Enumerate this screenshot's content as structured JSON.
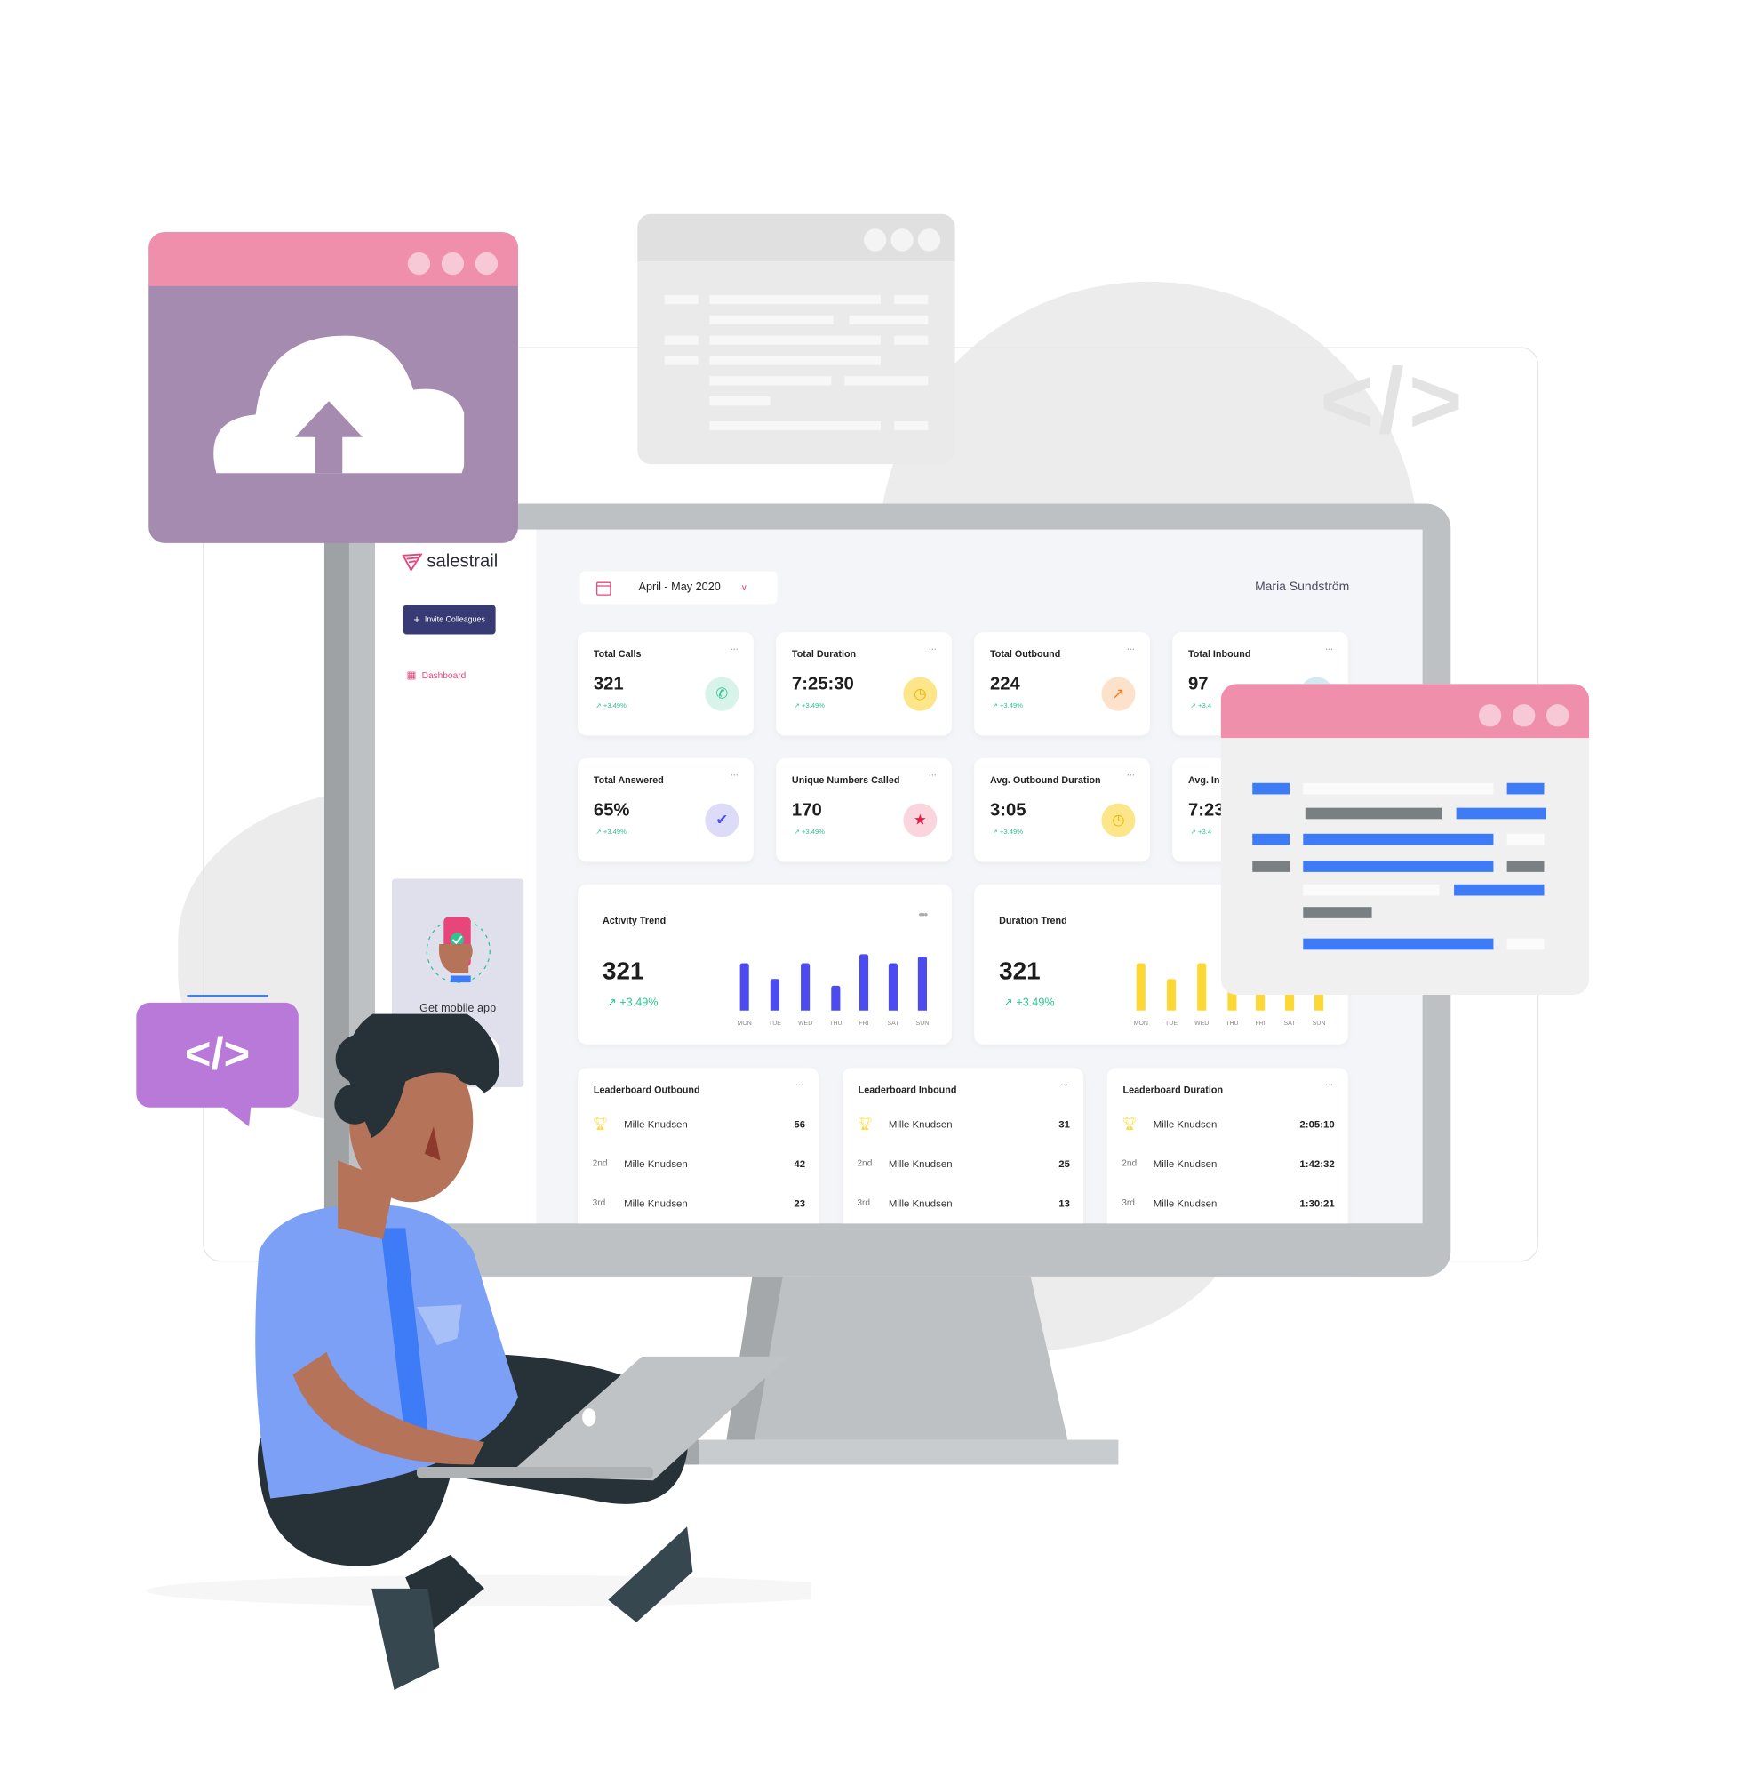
{
  "brand": {
    "logo": "salestrail",
    "accent": "#e8457a",
    "button_color": "#373a73"
  },
  "sidebar": {
    "invite_label": "Invite Colleagues",
    "nav": [
      {
        "label": "Dashboard",
        "icon": "grid-icon",
        "active": true
      }
    ],
    "mobile_label": "Get mobile app"
  },
  "header": {
    "date_range": "April - May 2020",
    "user_name": "Maria Sundström"
  },
  "stats": [
    {
      "title": "Total Calls",
      "value": "321",
      "change": "+3.49%",
      "icon": "phone-icon",
      "icon_bg": "#d8f3ea",
      "icon_color": "#2bc592"
    },
    {
      "title": "Total Duration",
      "value": "7:25:30",
      "change": "+3.49%",
      "icon": "clock-icon",
      "icon_bg": "#fde68a",
      "icon_color": "#e8b400"
    },
    {
      "title": "Total Outbound",
      "value": "224",
      "change": "+3.49%",
      "icon": "outgoing-call-icon",
      "icon_bg": "#fde2cb",
      "icon_color": "#f07a1a"
    },
    {
      "title": "Total Inbound",
      "value": "97",
      "change": "+3.4",
      "icon": "incoming-call-icon",
      "icon_bg": "#cfeaf0",
      "icon_color": "#3aa6c0"
    },
    {
      "title": "Total Answered",
      "value": "65%",
      "change": "+3.49%",
      "icon": "check-icon",
      "icon_bg": "#dcdcf8",
      "icon_color": "#4b4bef"
    },
    {
      "title": "Unique Numbers Called",
      "value": "170",
      "change": "+3.49%",
      "icon": "star-icon",
      "icon_bg": "#fbd5de",
      "icon_color": "#e0204a"
    },
    {
      "title": "Avg. Outbound Duration",
      "value": "3:05",
      "change": "+3.49%",
      "icon": "clock-icon",
      "icon_bg": "#fde68a",
      "icon_color": "#e8b400"
    },
    {
      "title": "Avg. In",
      "value": "7:23",
      "change": "+3.4",
      "icon": "clock-icon",
      "icon_bg": "#fde68a",
      "icon_color": "#e8b400"
    }
  ],
  "trends": [
    {
      "title": "Activity Trend",
      "value": "321",
      "change": "+3.49%"
    },
    {
      "title": "Duration Trend",
      "value": "321",
      "change": "+3.49%"
    }
  ],
  "chart_data": [
    {
      "type": "bar",
      "title": "Activity Trend",
      "categories": [
        "MON",
        "TUE",
        "WED",
        "THU",
        "FRI",
        "SAT",
        "SUN"
      ],
      "values": [
        0.84,
        0.56,
        0.84,
        0.44,
        1.0,
        0.84,
        0.96
      ],
      "color": "#4b4bef",
      "grid": false
    },
    {
      "type": "bar",
      "title": "Duration Trend",
      "categories": [
        "MON",
        "TUE",
        "WED",
        "THU",
        "FRI",
        "SAT",
        "SUN"
      ],
      "values": [
        0.84,
        0.56,
        0.84,
        0.44,
        1.0,
        0.84,
        0.96
      ],
      "color": "#fdd835",
      "grid": false
    }
  ],
  "leaderboards": [
    {
      "title": "Leaderboard Outbound",
      "rows": [
        {
          "rank": "trophy",
          "name": "Mille Knudsen",
          "value": "56"
        },
        {
          "rank": "2nd",
          "name": "Mille Knudsen",
          "value": "42"
        },
        {
          "rank": "3rd",
          "name": "Mille Knudsen",
          "value": "23"
        }
      ]
    },
    {
      "title": "Leaderboard Inbound",
      "rows": [
        {
          "rank": "trophy",
          "name": "Mille Knudsen",
          "value": "31"
        },
        {
          "rank": "2nd",
          "name": "Mille Knudsen",
          "value": "25"
        },
        {
          "rank": "3rd",
          "name": "Mille Knudsen",
          "value": "13"
        }
      ]
    },
    {
      "title": "Leaderboard Duration",
      "rows": [
        {
          "rank": "trophy",
          "name": "Mille Knudsen",
          "value": "2:05:10"
        },
        {
          "rank": "2nd",
          "name": "Mille Knudsen",
          "value": "1:42:32"
        },
        {
          "rank": "3rd",
          "name": "Mille Knudsen",
          "value": "1:30:21"
        }
      ]
    }
  ],
  "decor": {
    "code_symbol": "</>",
    "pink": "#f08fab",
    "purple": "#a58bb0",
    "bubble": "#b879d8"
  }
}
